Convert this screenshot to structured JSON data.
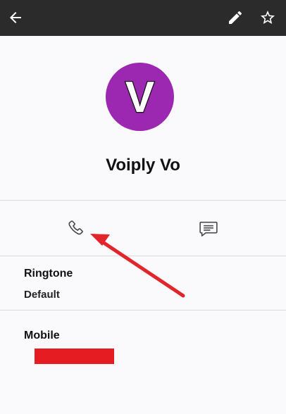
{
  "topbar": {
    "back_icon": "arrow-back-icon",
    "edit_icon": "pencil-icon",
    "star_icon": "star-outline-icon",
    "background": "#2b2b2b"
  },
  "contact": {
    "avatar_letter": "V",
    "avatar_color": "#9c27b0",
    "name": "Voiply Vo"
  },
  "actions": {
    "call_icon": "phone-icon",
    "message_icon": "message-icon"
  },
  "ringtone": {
    "title": "Ringtone",
    "value": "Default"
  },
  "mobile": {
    "title": "Mobile",
    "redaction_color": "#e51c22"
  },
  "annotation": {
    "arrow_color": "#e0262a"
  }
}
